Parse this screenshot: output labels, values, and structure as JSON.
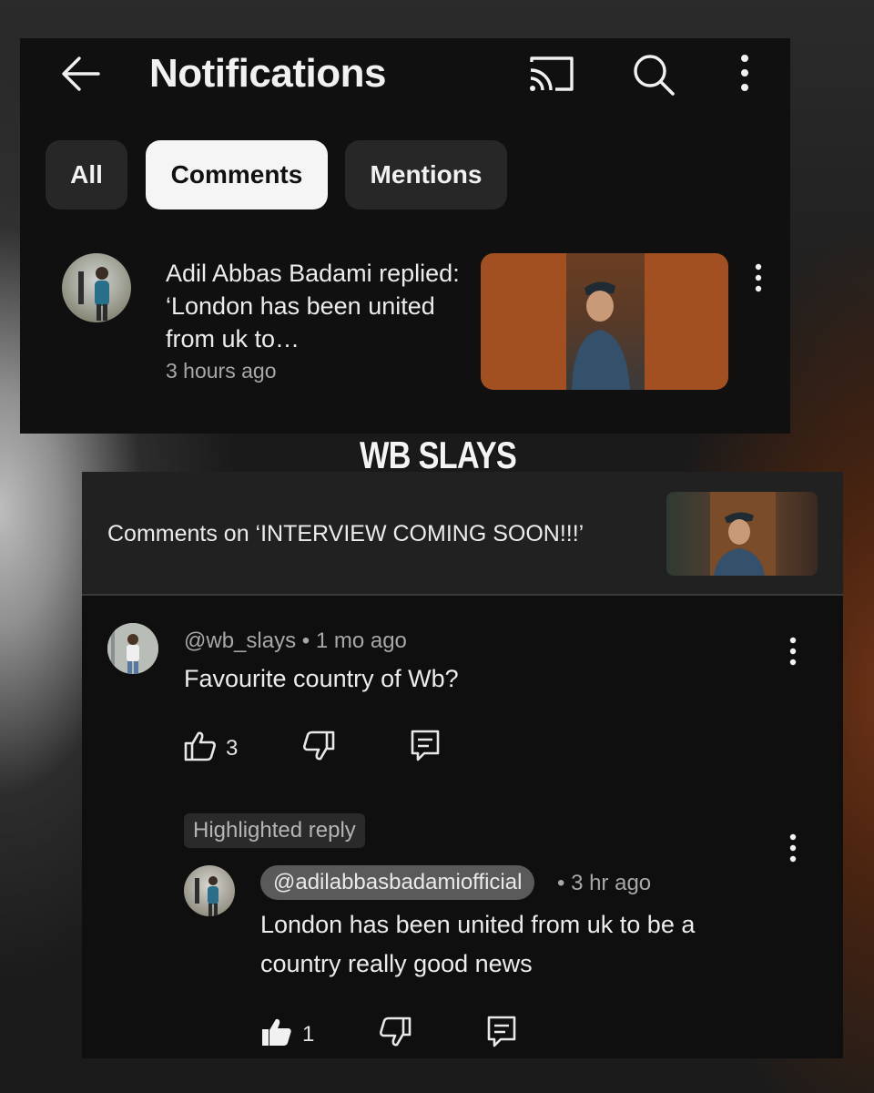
{
  "notifications_panel": {
    "title": "Notifications",
    "icons": [
      "back-arrow-icon",
      "cast-icon",
      "search-icon",
      "more-vert-icon"
    ],
    "chips": [
      {
        "label": "All",
        "active": false
      },
      {
        "label": "Comments",
        "active": true
      },
      {
        "label": "Mentions",
        "active": false
      }
    ],
    "notification": {
      "text": "Adil Abbas Badami replied: ‘London has been united from uk to…",
      "time": "3 hours ago"
    }
  },
  "watermark": "WB SLAYS",
  "comments_panel": {
    "header": "Comments on ‘INTERVIEW COMING SOON!!!’",
    "comment": {
      "handle": "@wb_slays",
      "time": "• 1 mo ago",
      "text": "Favourite country of Wb?",
      "likes": "3"
    },
    "reply": {
      "badge": "Highlighted reply",
      "handle": "@adilabbasbadamiofficial",
      "time": "• 3 hr ago",
      "text": "London has been united from uk to be a country really good news",
      "likes": "1"
    }
  },
  "colors": {
    "panel_bg": "#101010",
    "chip_bg": "#272727",
    "chip_active_bg": "#f5f5f5",
    "thumb_accent": "#a24f22",
    "text_primary": "#ececec",
    "text_secondary": "#a8a8a8"
  }
}
